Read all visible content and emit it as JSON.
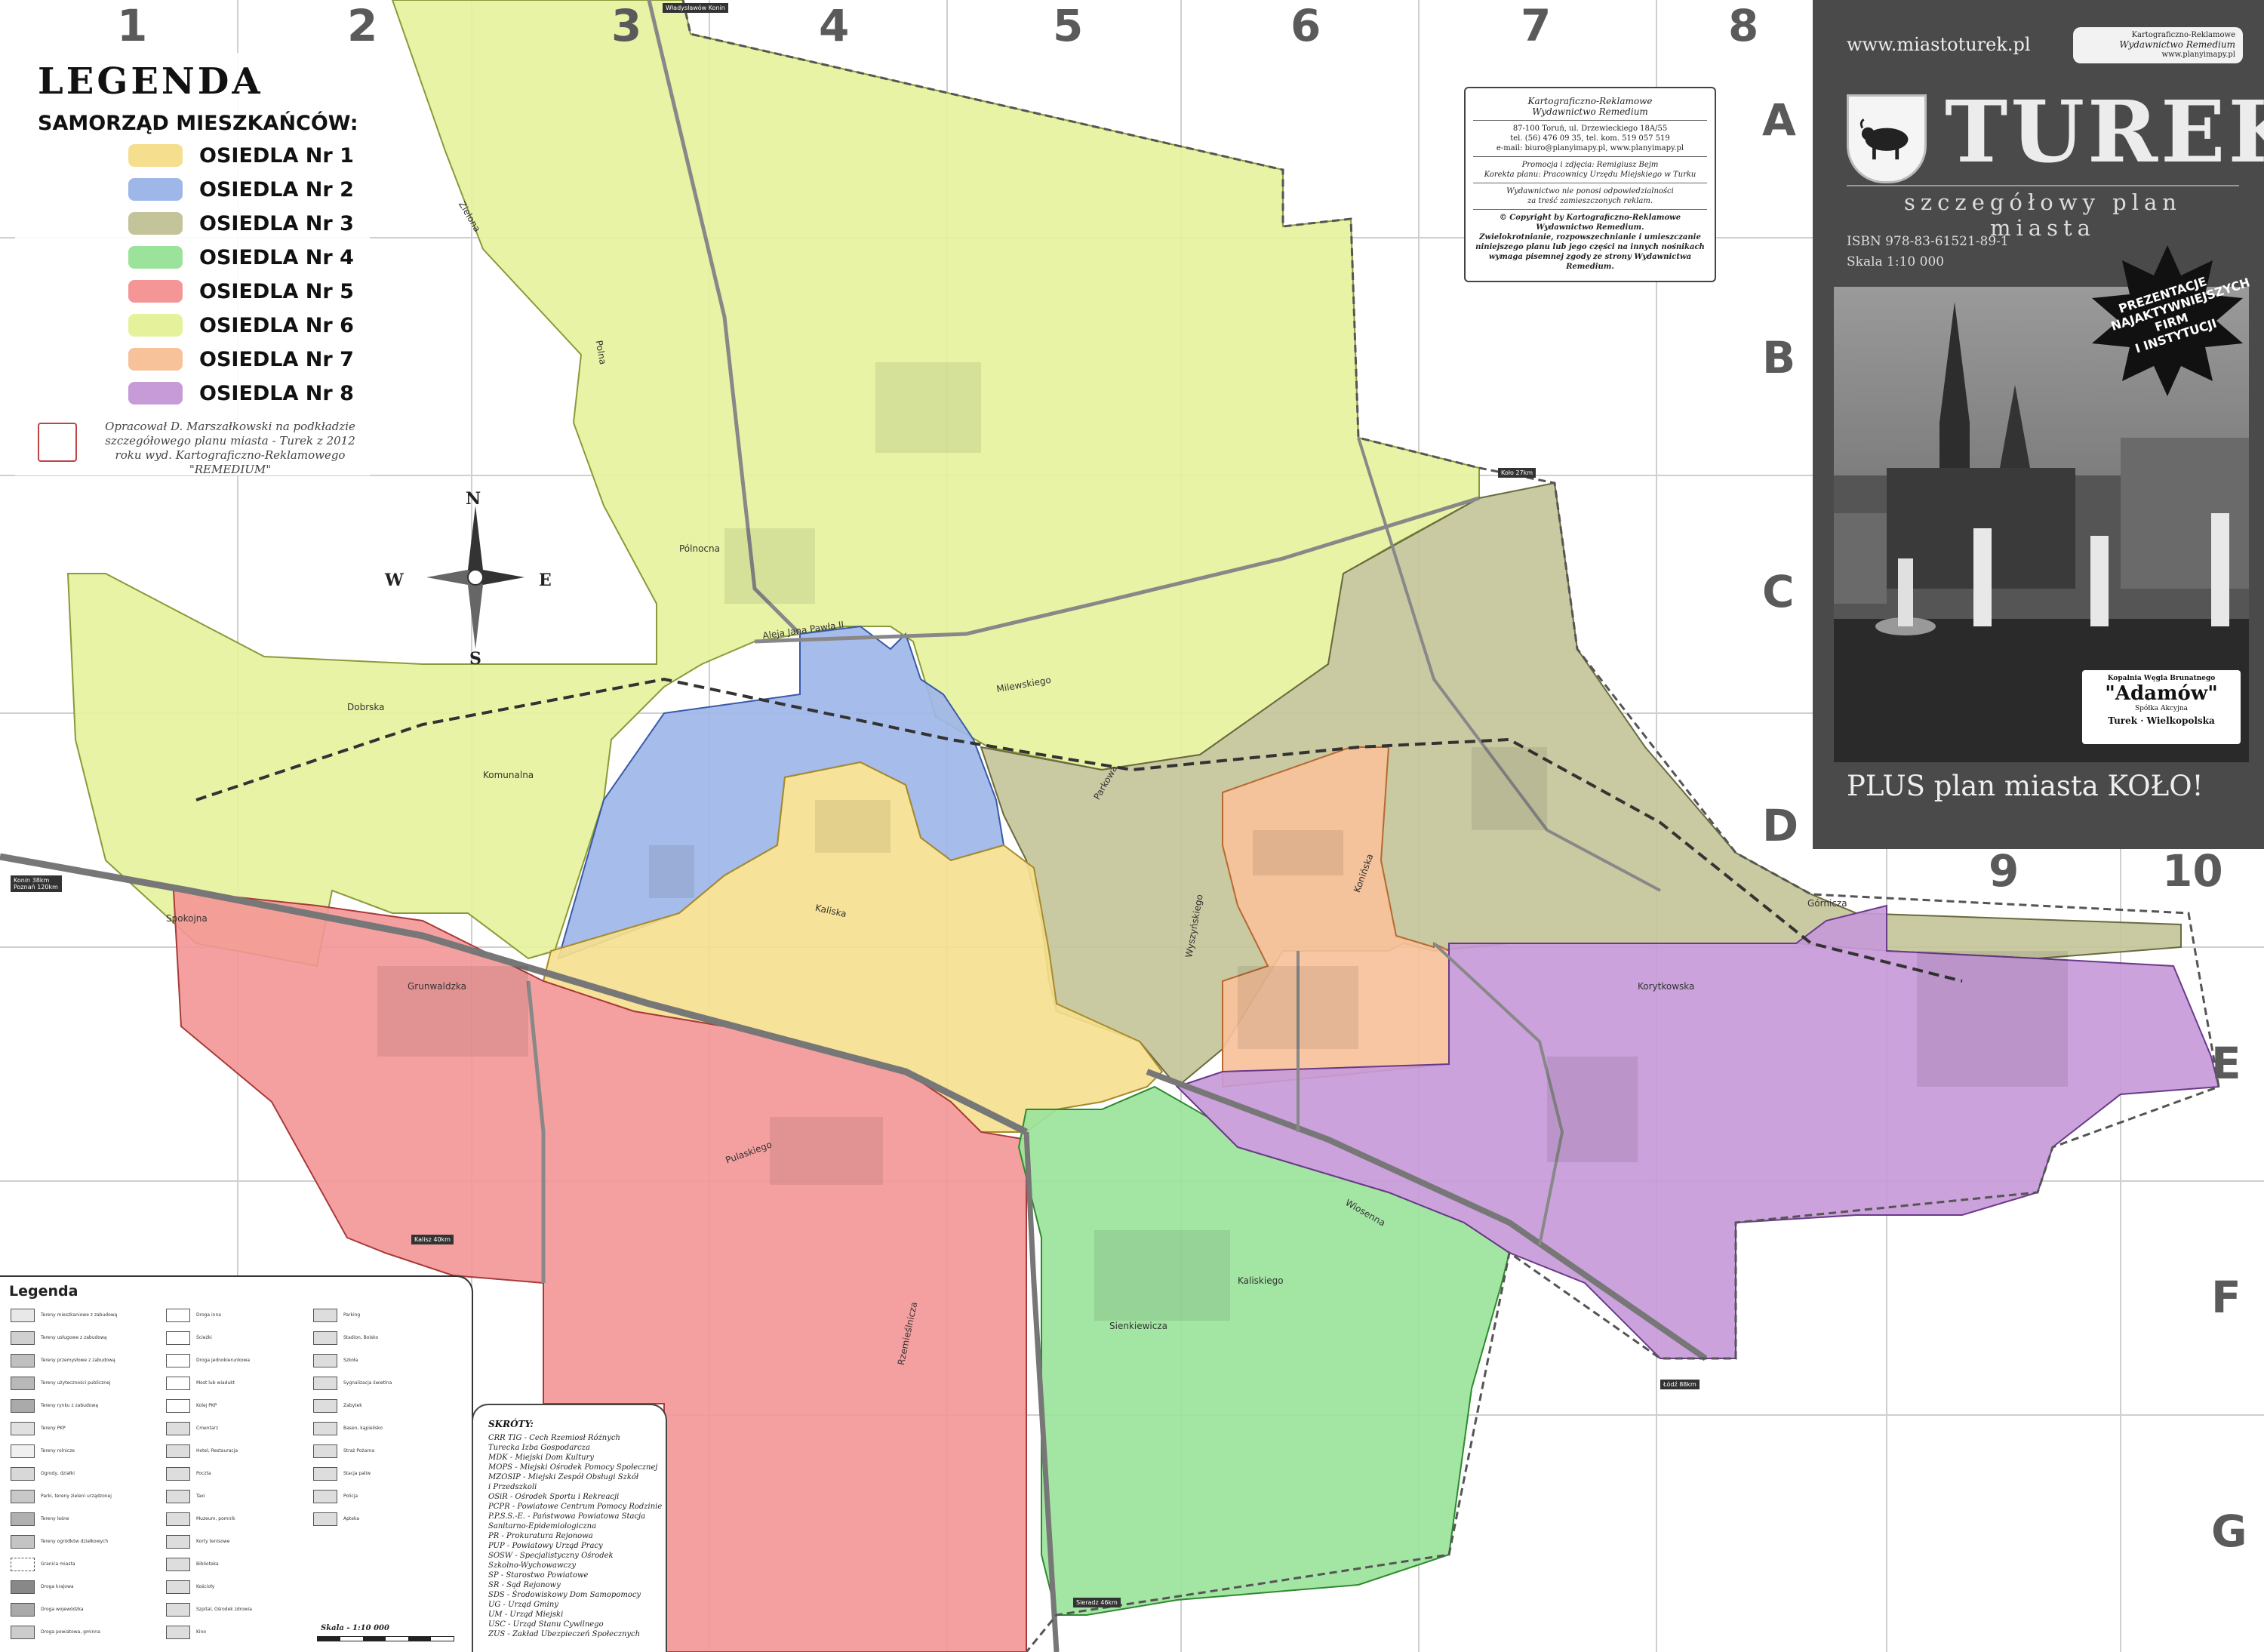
{
  "grid": {
    "columns": [
      "1",
      "2",
      "3",
      "4",
      "5",
      "6",
      "7",
      "8",
      "9",
      "10"
    ],
    "rows": [
      "A",
      "B",
      "C",
      "D",
      "E",
      "F",
      "G"
    ]
  },
  "legend": {
    "title": "LEGENDA",
    "subtitle": "SAMORZĄD MIESZKAŃCÓW:",
    "items": [
      {
        "label": "OSIEDLA Nr 1",
        "color": "#f5df8f"
      },
      {
        "label": "OSIEDLA Nr 2",
        "color": "#9eb6e8"
      },
      {
        "label": "OSIEDLA Nr 3",
        "color": "#c4c49a"
      },
      {
        "label": "OSIEDLA Nr 4",
        "color": "#9be39b"
      },
      {
        "label": "OSIEDLA Nr 5",
        "color": "#f49696"
      },
      {
        "label": "OSIEDLA Nr 6",
        "color": "#e5f29b"
      },
      {
        "label": "OSIEDLA Nr 7",
        "color": "#f7c19a"
      },
      {
        "label": "OSIEDLA Nr 8",
        "color": "#c79ad8"
      }
    ],
    "credit": "Opracował D. Marszałkowski na podkładzie szczegółowego planu miasta - Turek z 2012 roku wyd. Kartograficzno-Reklamowego \"REMEDIUM\""
  },
  "compass": {
    "n": "N",
    "s": "S",
    "e": "E",
    "w": "W"
  },
  "publisher": {
    "name_line1": "Kartograficzno-Reklamowe",
    "name_line2": "Wydawnictwo Remedium",
    "address": "87-100 Toruń, ul. Drzewieckiego 18A/55",
    "phone": "tel. (56) 476 09 35, tel. kom. 519 057 519",
    "email": "e-mail: biuro@planyimapy.pl, www.planyimapy.pl",
    "promo": "Promocja i zdjęcia: Remigiusz Bejm",
    "correction": "Korekta planu: Pracownicy Urzędu Miejskiego w Turku",
    "disclaimer1": "Wydawnictwo nie ponosi odpowiedzialności",
    "disclaimer2": "za treść zamieszczonych reklam.",
    "copyright1": "© Copyright by Kartograficzno-Reklamowe",
    "copyright2": "Wydawnictwo Remedium.",
    "copyright3": "Zwielokrotnianie, rozpowszechnianie i umieszczanie",
    "copyright4": "niniejszego planu lub jego części na innych nośnikach",
    "copyright5": "wymaga pisemnej zgody ze strony Wydawnictwa Remedium."
  },
  "cover": {
    "url": "www.miastoturek.pl",
    "badge_line1": "Kartograficzno-Reklamowe",
    "badge_line2": "Wydawnictwo Remedium",
    "badge_line3": "www.planyimapy.pl",
    "title": "TUREK",
    "subtitle": "szczegółowy plan miasta",
    "isbn": "ISBN 978-83-61521-89-1",
    "scale": "Skala 1:10 000",
    "promo_line1": "PREZENTACJE",
    "promo_line2": "NAJAKTYWNIEJSZYCH",
    "promo_line3": "FIRM",
    "promo_line4": "I INSTYTUCJI",
    "sponsor_top": "Kopalnia Węgla Brunatnego",
    "sponsor_name": "\"Adamów\"",
    "sponsor_sub": "Spółka Akcyjna",
    "sponsor_city": "Turek · Wielkopolska",
    "plus": "PLUS plan miasta KOŁO!"
  },
  "streets": [
    "Aleja Jana Pawła II",
    "Milewskiego",
    "Kaliska",
    "Konińska",
    "Polna",
    "Korytkowska",
    "Pulaskiego",
    "Komunalna",
    "Grunwaldzka",
    "Wyszyńskiego",
    "Kaliskiego",
    "Sienkiewicza",
    "Górnicza",
    "Zielona",
    "Pólnocna",
    "Spokojna",
    "Wiosenna",
    "Dobrska",
    "Rzemieślnicza",
    "Parkowa"
  ],
  "road_signs": [
    {
      "text": "Władysławów Konin"
    },
    {
      "text": "Koło 27km"
    },
    {
      "text": "Konin 38km Poznań 120km"
    },
    {
      "text": "Kalisz 40km"
    },
    {
      "text": "Łódź 88km"
    },
    {
      "text": "Sieradz 46km"
    }
  ],
  "symbols_legend": {
    "title": "Legenda",
    "items": [
      "Tereny mieszkaniowe z zabudową",
      "Tereny usługowe z zabudową",
      "Tereny przemysłowe z zabudową",
      "Tereny użyteczności publicznej",
      "Tereny rynku z zabudową",
      "Tereny PKP",
      "Tereny rolnicze",
      "Ogrody, działki",
      "Parki, tereny zieleni urządzonej",
      "Tereny leśne",
      "Tereny ogródków działkowych",
      "Granica miasta",
      "Droga krajowa",
      "Droga wojewódzka",
      "Droga powiatowa, gminna",
      "Droga inna",
      "Ścieżki",
      "Droga jednokierunkowa",
      "Most lub wiadukt",
      "Kolej PKP",
      "Cmentarz",
      "Hotel, Restauracja",
      "Poczta",
      "Taxi",
      "Muzeum, pomnik",
      "Korty tenisowe",
      "Biblioteka",
      "Kościoły",
      "Szpital, Ośrodek zdrowia",
      "Kino",
      "Parking",
      "Stadion, Boisko",
      "Szkoła",
      "Sygnalizacja świetlna",
      "Zabytek",
      "Basen, kąpielisko",
      "Straż Pożarna",
      "Stacja paliw",
      "Policja",
      "Apteka"
    ]
  },
  "abbreviations": {
    "title": "SKRÓTY:",
    "lines": [
      "CRR TIG - Cech Rzemiosł Różnych",
      "Turecka Izba Gospodarcza",
      "MDK - Miejski Dom Kultury",
      "MOPS - Miejski Ośrodek Pomocy Społecznej",
      "MZOSIP - Miejski Zespół Obsługi Szkół",
      "i Przedszkoli",
      "OSiR - Ośrodek Sportu i Rekreacji",
      "PCPR - Powiatowe Centrum Pomocy Rodzinie",
      "P.P.S.S.-E. - Państwowa Powiatowa Stacja",
      "Sanitarno-Epidemiologiczna",
      "PR - Prokuratura Rejonowa",
      "PUP - Powiatowy Urząd Pracy",
      "SOSW - Specjalistyczny Ośrodek",
      "Szkolno-Wychowawczy",
      "SP - Starostwo Powiatowe",
      "SR - Sąd Rejonowy",
      "SDS - Środowiskowy Dom Samopomocy",
      "UG - Urząd Gminy",
      "UM - Urząd Miejski",
      "USC - Urząd Stanu Cywilnego",
      "ZUS - Zakład Ubezpieczeń Społecznych"
    ],
    "scale": "Skala - 1:10 000"
  }
}
